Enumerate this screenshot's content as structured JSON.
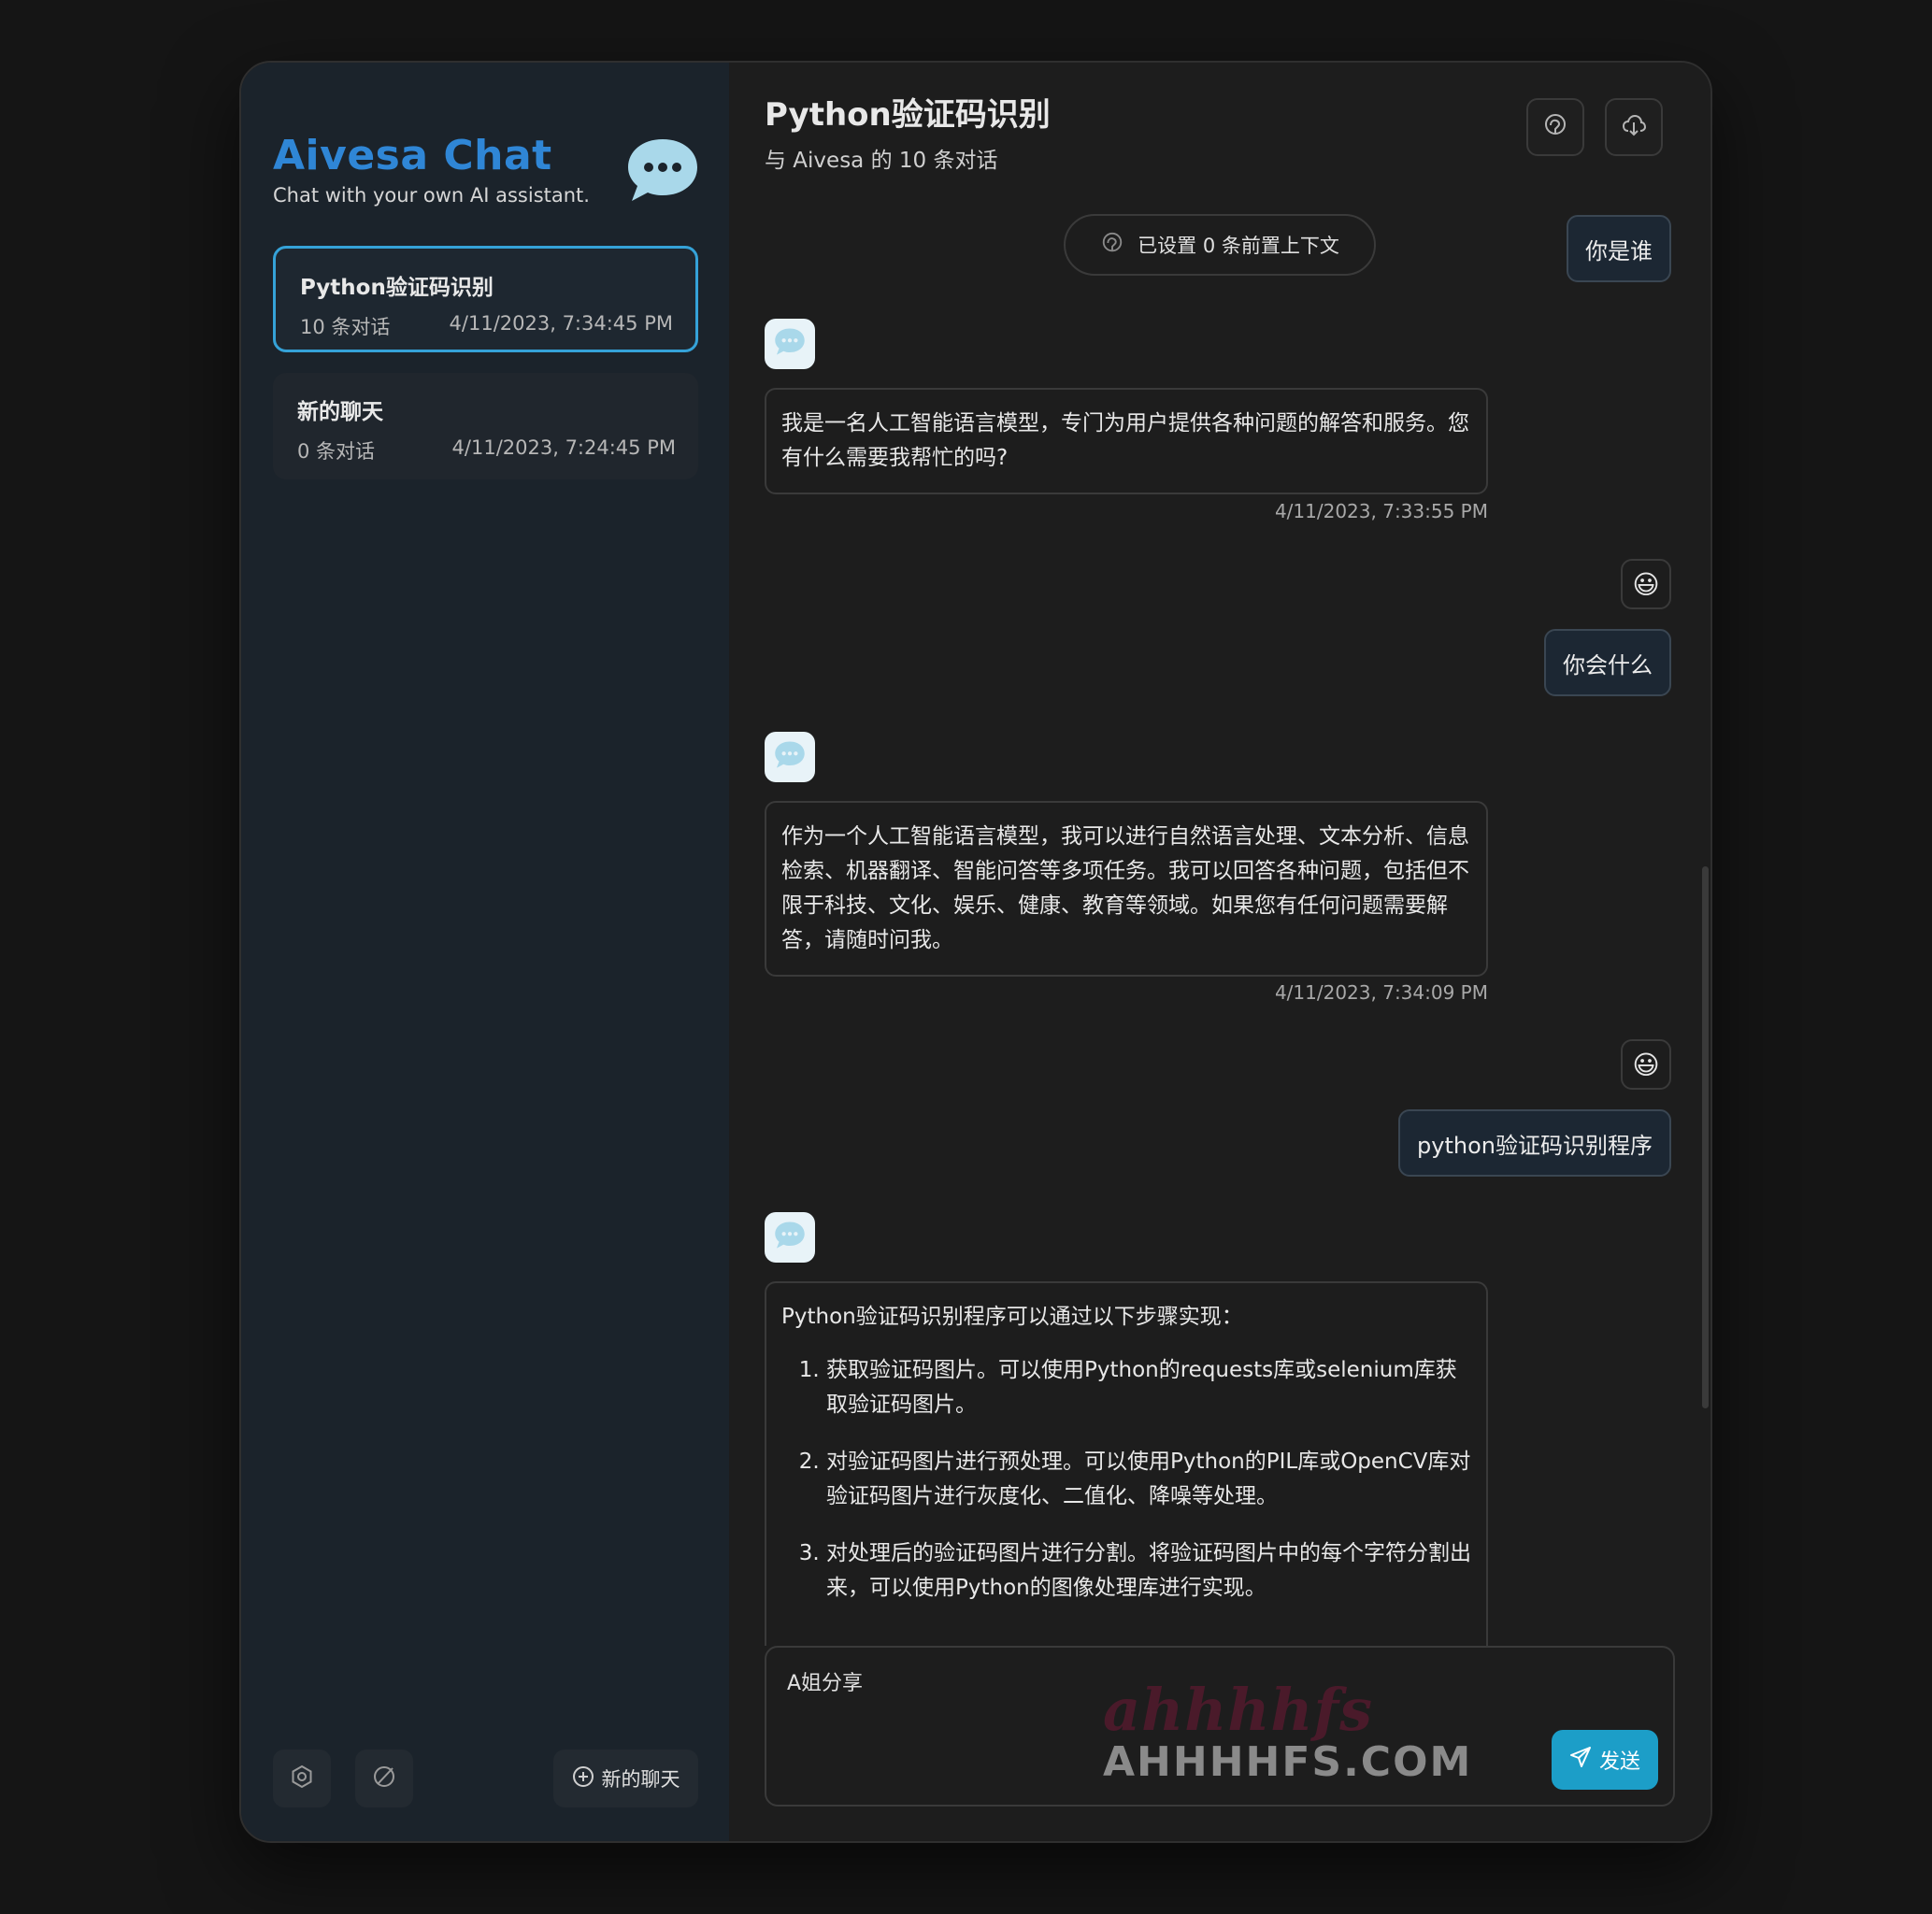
{
  "sidebar": {
    "app_title": "Aivesa Chat",
    "app_subtitle": "Chat with your own AI assistant.",
    "logo_icon": "chat-bubble-icon",
    "chats": [
      {
        "title": "Python验证码识别",
        "count": "10 条对话",
        "time": "4/11/2023, 7:34:45 PM",
        "active": true
      },
      {
        "title": "新的聊天",
        "count": "0 条对话",
        "time": "4/11/2023, 7:24:45 PM",
        "active": false
      }
    ],
    "settings_icon": "settings-icon",
    "clear_icon": "clear-icon",
    "new_chat_label": "新的聊天"
  },
  "header": {
    "title": "Python验证码识别",
    "subtitle": "与 Aivesa 的 10 条对话",
    "prompt_icon": "prompt-icon",
    "export_icon": "cloud-download-icon"
  },
  "context_pill": "已设置 0 条前置上下文",
  "messages": {
    "user1": "你是谁",
    "ai1": "我是一名人工智能语言模型，专门为用户提供各种问题的解答和服务。您有什么需要我帮忙的吗?",
    "ai1_time": "4/11/2023, 7:33:55 PM",
    "user2": "你会什么",
    "ai2": "作为一个人工智能语言模型，我可以进行自然语言处理、文本分析、信息检索、机器翻译、智能问答等多项任务。我可以回答各种问题，包括但不限于科技、文化、娱乐、健康、教育等领域。如果您有任何问题需要解答，请随时问我。",
    "ai2_time": "4/11/2023, 7:34:09 PM",
    "user3": "python验证码识别程序",
    "ai3_intro": "Python验证码识别程序可以通过以下步骤实现：",
    "ai3_steps": [
      "获取验证码图片。可以使用Python的requests库或selenium库获取验证码图片。",
      "对验证码图片进行预处理。可以使用Python的PIL库或OpenCV库对验证码图片进行灰度化、二值化、降噪等处理。",
      "对处理后的验证码图片进行分割。将验证码图片中的每个字符分割出来，可以使用Python的图像处理库进行实现。"
    ]
  },
  "input": {
    "value": "A姐分享",
    "send_label": "发送"
  },
  "watermark": {
    "script": "ahhhhfs",
    "domain": "AHHHHFS.COM"
  },
  "colors": {
    "accent": "#2f86d6",
    "send": "#1c9ec8",
    "active_border": "#35a2d8"
  }
}
